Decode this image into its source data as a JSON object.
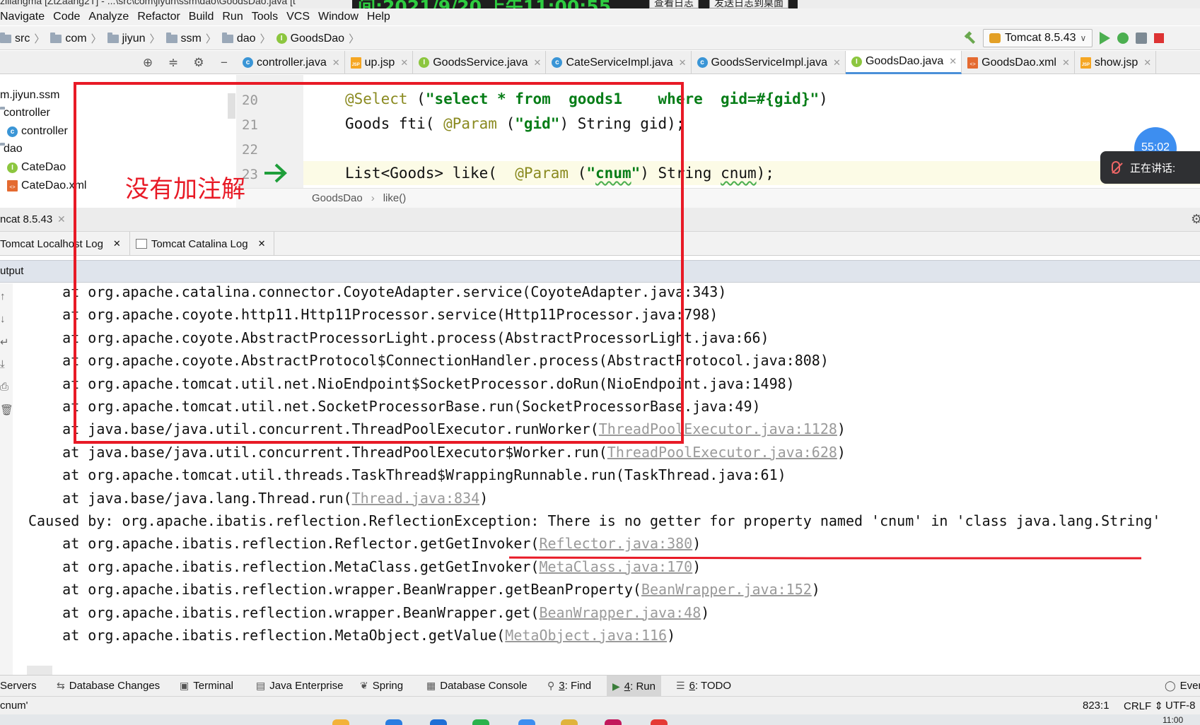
{
  "window": {
    "title_fragment": "ziliangma [ZtZaang2T] - ...\\src\\com\\jiyun\\ssm\\dao\\GoodsDao.java [t",
    "recorder_time": "间:2021/9/20 上午11:00:55",
    "recorder_buttons": [
      "查看日志",
      "发送日志到桌面"
    ]
  },
  "menu": [
    "Navigate",
    "Code",
    "Analyze",
    "Refactor",
    "Build",
    "Run",
    "Tools",
    "VCS",
    "Window",
    "Help"
  ],
  "breadcrumb": [
    "src",
    "com",
    "jiyun",
    "ssm",
    "dao",
    "GoodsDao"
  ],
  "run_config": "Tomcat 8.5.43",
  "editor_tabs": [
    {
      "label": "controller.java",
      "icon": "class-icon",
      "active": false
    },
    {
      "label": "up.jsp",
      "icon": "jsp-icon",
      "active": false
    },
    {
      "label": "GoodsService.java",
      "icon": "interface-icon",
      "active": false
    },
    {
      "label": "CateServiceImpl.java",
      "icon": "class-icon",
      "active": false
    },
    {
      "label": "GoodsServiceImpl.java",
      "icon": "class-icon",
      "active": false
    },
    {
      "label": "GoodsDao.java",
      "icon": "interface-icon",
      "active": true
    },
    {
      "label": "GoodsDao.xml",
      "icon": "xml-icon",
      "active": false
    },
    {
      "label": "show.jsp",
      "icon": "jsp-icon",
      "active": false
    }
  ],
  "project_tree": [
    {
      "label": "m.jiyun.ssm",
      "icon": "none"
    },
    {
      "label": "controller",
      "icon": "folder-icon"
    },
    {
      "label": "controller",
      "icon": "class-icon"
    },
    {
      "label": "dao",
      "icon": "folder-icon"
    },
    {
      "label": "CateDao",
      "icon": "interface-icon"
    },
    {
      "label": "CateDao.xml",
      "icon": "xml-icon"
    }
  ],
  "editor": {
    "line_numbers": [
      "20",
      "21",
      "22",
      "23"
    ],
    "line20": {
      "ann": "@Select",
      "open": " (",
      "str1": "\"select * from  goods1    where  gid=#{gid}\"",
      "close": ")"
    },
    "line21": {
      "pre": "Goods fti( ",
      "ann": "@Param",
      "open": " (",
      "str": "\"gid\"",
      "post": ") String gid);"
    },
    "line23": {
      "pre": "List<Goods> like(  ",
      "ann": "@Param",
      "open": " (",
      "q1": "\"",
      "str": "cnum",
      "q2": "\"",
      "post": ") String ",
      "param": "cnum",
      "end": ");"
    },
    "breadcrumb": [
      "GoodsDao",
      "like()"
    ]
  },
  "meeting": {
    "timer": "55:02",
    "speaking_label": "正在讲话:"
  },
  "run_panel": {
    "title": "ncat 8.5.43",
    "log_tabs": [
      "Tomcat Localhost Log",
      "Tomcat Catalina Log"
    ],
    "output_label": "utput"
  },
  "console_lines": [
    {
      "text": "    at org.apache.catalina.connector.CoyoteAdapter.service(CoyoteAdapter.java:343)",
      "link": ""
    },
    {
      "text": "    at org.apache.coyote.http11.Http11Processor.service(Http11Processor.java:798)",
      "link": ""
    },
    {
      "text": "    at org.apache.coyote.AbstractProcessorLight.process(AbstractProcessorLight.java:66)",
      "link": ""
    },
    {
      "text": "    at org.apache.coyote.AbstractProtocol$ConnectionHandler.process(AbstractProtocol.java:808)",
      "link": ""
    },
    {
      "text": "    at org.apache.tomcat.util.net.NioEndpoint$SocketProcessor.doRun(NioEndpoint.java:1498)",
      "link": ""
    },
    {
      "text": "    at org.apache.tomcat.util.net.SocketProcessorBase.run(SocketProcessorBase.java:49)",
      "link": ""
    },
    {
      "text": "    at java.base/java.util.concurrent.ThreadPoolExecutor.runWorker(",
      "link": "ThreadPoolExecutor.java:1128",
      "tail": ")"
    },
    {
      "text": "    at java.base/java.util.concurrent.ThreadPoolExecutor$Worker.run(",
      "link": "ThreadPoolExecutor.java:628",
      "tail": ")"
    },
    {
      "text": "    at org.apache.tomcat.util.threads.TaskThread$WrappingRunnable.run(TaskThread.java:61)",
      "link": ""
    },
    {
      "text": "    at java.base/java.lang.Thread.run(",
      "link": "Thread.java:834",
      "tail": ")"
    },
    {
      "text": "Caused by: org.apache.ibatis.reflection.ReflectionException: There is no getter for property named 'cnum' in 'class java.lang.String'",
      "link": ""
    },
    {
      "text": "    at org.apache.ibatis.reflection.Reflector.getGetInvoker(",
      "link": "Reflector.java:380",
      "tail": ")"
    },
    {
      "text": "    at org.apache.ibatis.reflection.MetaClass.getGetInvoker(",
      "link": "MetaClass.java:170",
      "tail": ")"
    },
    {
      "text": "    at org.apache.ibatis.reflection.wrapper.BeanWrapper.getBeanProperty(",
      "link": "BeanWrapper.java:152",
      "tail": ")"
    },
    {
      "text": "    at org.apache.ibatis.reflection.wrapper.BeanWrapper.get(",
      "link": "BeanWrapper.java:48",
      "tail": ")"
    },
    {
      "text": "    at org.apache.ibatis.reflection.MetaObject.getValue(",
      "link": "MetaObject.java:116",
      "tail": ")"
    }
  ],
  "annotation": {
    "note": "没有加注解",
    "color": "#e81a26"
  },
  "tool_windows": [
    {
      "label": "Servers",
      "mnemonic": ""
    },
    {
      "label": "Database Changes",
      "mnemonic": ""
    },
    {
      "label": "Terminal",
      "mnemonic": ""
    },
    {
      "label": "Java Enterprise",
      "mnemonic": ""
    },
    {
      "label": "Spring",
      "mnemonic": ""
    },
    {
      "label": "Database Console",
      "mnemonic": ""
    },
    {
      "label": ": Find",
      "mnemonic": "3"
    },
    {
      "label": ": Run",
      "mnemonic": "4"
    },
    {
      "label": ": TODO",
      "mnemonic": "6"
    },
    {
      "label": "Even",
      "mnemonic": ""
    }
  ],
  "status": {
    "message": "cnum'",
    "position": "823:1",
    "line_sep": "CRLF",
    "encoding": "UTF-8"
  },
  "taskbar_clock": "11:00"
}
